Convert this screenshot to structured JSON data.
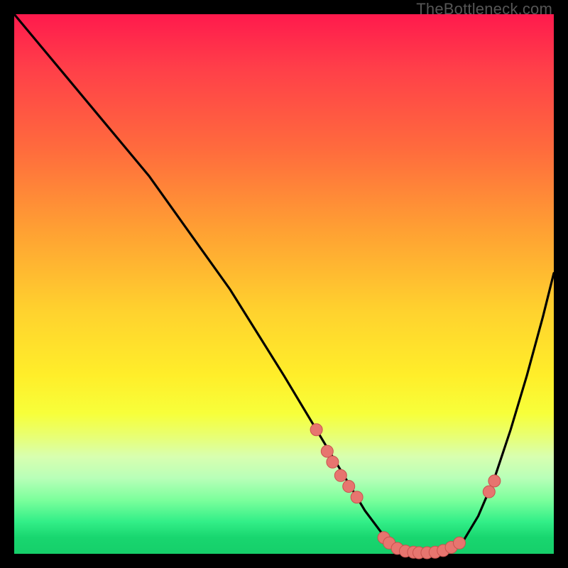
{
  "watermark": "TheBottleneck.com",
  "colors": {
    "background": "#000000",
    "curve": "#000000",
    "dot_fill": "#e7756f",
    "dot_stroke": "#c9524e"
  },
  "chart_data": {
    "type": "line",
    "title": "",
    "xlabel": "",
    "ylabel": "",
    "xlim": [
      0,
      100
    ],
    "ylim": [
      0,
      100
    ],
    "series": [
      {
        "name": "bottleneck-curve",
        "x": [
          0,
          5,
          10,
          15,
          20,
          25,
          30,
          35,
          40,
          45,
          50,
          53,
          56,
          59,
          62,
          65,
          68,
          71,
          74,
          77,
          80,
          83,
          86,
          89,
          92,
          95,
          98,
          100
        ],
        "y": [
          100,
          94,
          88,
          82,
          76,
          70,
          63,
          56,
          49,
          41,
          33,
          28,
          23,
          18,
          13,
          8,
          4,
          1,
          0,
          0,
          0,
          2,
          7,
          14,
          23,
          33,
          44,
          52
        ]
      }
    ],
    "markers": [
      {
        "x": 56.0,
        "y": 23.0
      },
      {
        "x": 58.0,
        "y": 19.0
      },
      {
        "x": 59.0,
        "y": 17.0
      },
      {
        "x": 60.5,
        "y": 14.5
      },
      {
        "x": 62.0,
        "y": 12.5
      },
      {
        "x": 63.5,
        "y": 10.5
      },
      {
        "x": 68.5,
        "y": 3.0
      },
      {
        "x": 69.5,
        "y": 2.0
      },
      {
        "x": 71.0,
        "y": 1.0
      },
      {
        "x": 72.5,
        "y": 0.5
      },
      {
        "x": 74.0,
        "y": 0.3
      },
      {
        "x": 75.0,
        "y": 0.2
      },
      {
        "x": 76.5,
        "y": 0.2
      },
      {
        "x": 78.0,
        "y": 0.3
      },
      {
        "x": 79.5,
        "y": 0.6
      },
      {
        "x": 81.0,
        "y": 1.2
      },
      {
        "x": 82.5,
        "y": 2.0
      },
      {
        "x": 88.0,
        "y": 11.5
      },
      {
        "x": 89.0,
        "y": 13.5
      }
    ]
  }
}
